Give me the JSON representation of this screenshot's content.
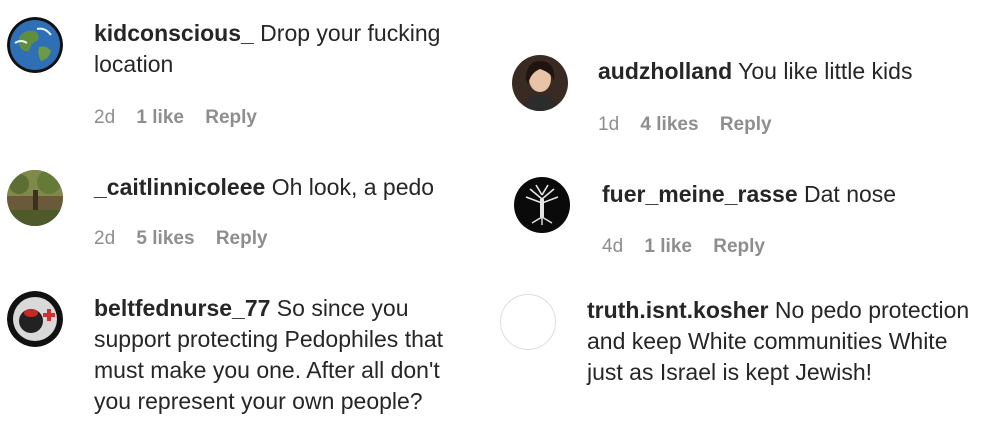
{
  "comments": [
    {
      "username": "kidconscious_",
      "text": "Drop your fucking location",
      "time": "2d",
      "likes": "1 like",
      "reply": "Reply",
      "avatar_icon": "earth-icon"
    },
    {
      "username": "audzholland",
      "text": "You like little kids",
      "time": "1d",
      "likes": "4 likes",
      "reply": "Reply",
      "avatar_icon": "person-photo-icon"
    },
    {
      "username": "_caitlinnicoleee",
      "text": "Oh look, a pedo",
      "time": "2d",
      "likes": "5 likes",
      "reply": "Reply",
      "avatar_icon": "forest-photo-icon"
    },
    {
      "username": "fuer_meine_rasse",
      "text": "Dat nose",
      "time": "4d",
      "likes": "1 like",
      "reply": "Reply",
      "avatar_icon": "tree-logo-icon"
    },
    {
      "username": "beltfednurse_77",
      "text": "So since you support protecting Pedophiles that must make you one. After all don't you represent your own people?",
      "avatar_icon": "nurse-badge-icon"
    },
    {
      "username": "truth.isnt.kosher",
      "text": "No pedo protection and keep White communities White just as Israel is kept Jewish!",
      "avatar_icon": "blank-avatar-icon"
    }
  ]
}
